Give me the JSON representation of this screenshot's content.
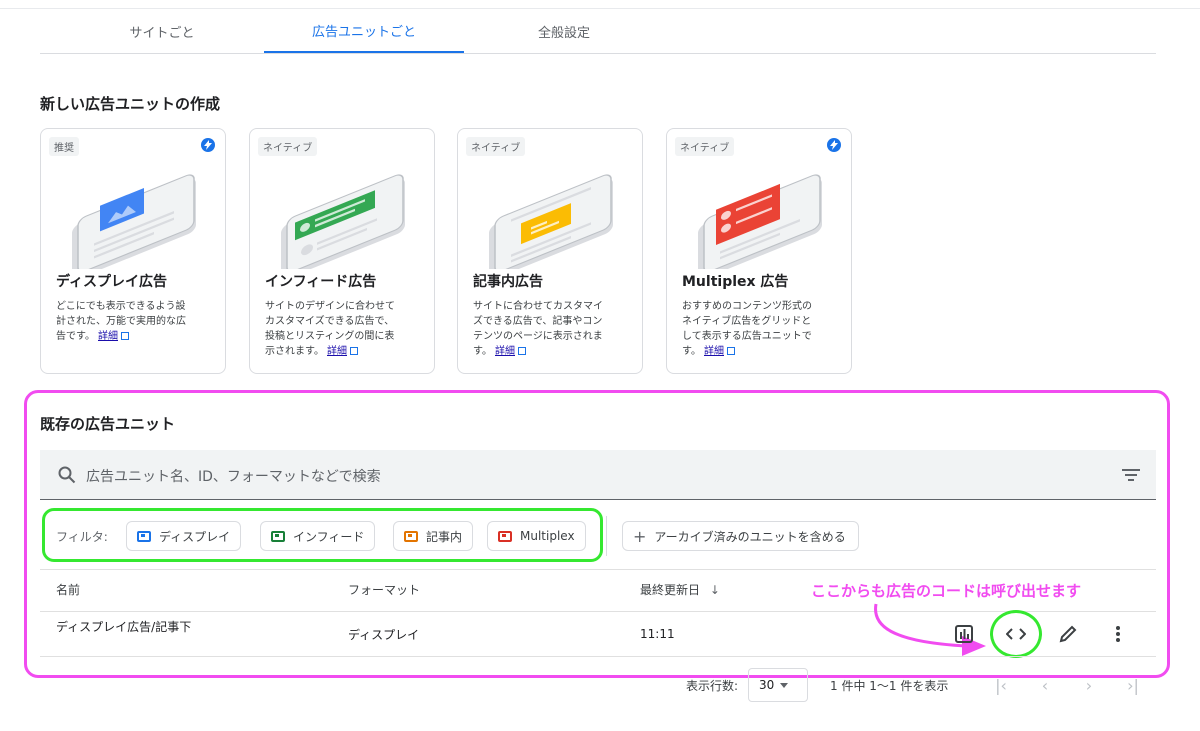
{
  "tabs": [
    {
      "label": "サイトごと",
      "active": false
    },
    {
      "label": "広告ユニットごと",
      "active": true
    },
    {
      "label": "全般設定",
      "active": false
    }
  ],
  "create_section": {
    "title": "新しい広告ユニットの作成",
    "cards": [
      {
        "tag": "推奨",
        "bolt": true,
        "accent": "#4285f4",
        "title": "ディスプレイ広告",
        "desc_lines": [
          "どこにでも表示できるよう設",
          "計された、万能で実用的な広",
          "告です。"
        ],
        "more": "詳細"
      },
      {
        "tag": "ネイティブ",
        "bolt": false,
        "accent": "#34a853",
        "title": "インフィード広告",
        "desc_lines": [
          "サイトのデザインに合わせて",
          "カスタマイズできる広告で、",
          "投稿とリスティングの間に表",
          "示されます。"
        ],
        "more": "詳細"
      },
      {
        "tag": "ネイティブ",
        "bolt": false,
        "accent": "#fbbc04",
        "title": "記事内広告",
        "desc_lines": [
          "サイトに合わせてカスタマイ",
          "ズできる広告で、記事やコン",
          "テンツのページに表示されま",
          "す。"
        ],
        "more": "詳細"
      },
      {
        "tag": "ネイティブ",
        "bolt": true,
        "accent": "#ea4335",
        "title": "Multiplex 広告",
        "desc_lines": [
          "おすすめのコンテンツ形式の",
          "ネイティブ広告をグリッドと",
          "して表示する広告ユニットで",
          "す。"
        ],
        "more": "詳細"
      }
    ]
  },
  "existing_section": {
    "title": "既存の広告ユニット",
    "search_placeholder": "広告ユニット名、ID、フォーマットなどで検索",
    "filter_label": "フィルタ:",
    "filters": [
      {
        "label": "ディスプレイ",
        "color": "#1a73e8"
      },
      {
        "label": "インフィード",
        "color": "#188038"
      },
      {
        "label": "記事内",
        "color": "#e37400"
      },
      {
        "label": "Multiplex",
        "color": "#d93025"
      }
    ],
    "archive_label": "アーカイブ済みのユニットを含める",
    "columns": {
      "name": "名前",
      "format": "フォーマット",
      "updated": "最終更新日"
    },
    "rows": [
      {
        "name": "ディスプレイ広告/記事下",
        "format": "ディスプレイ",
        "updated": "11:11"
      }
    ],
    "row_actions": [
      "report-icon",
      "code-icon",
      "edit-icon",
      "more-vert-icon"
    ]
  },
  "annotation": "ここからも広告のコードは呼び出せます",
  "pagination": {
    "rows_label": "表示行数:",
    "rows_value": "30",
    "range": "1 件中 1〜1 件を表示"
  },
  "colors": {
    "accent": "#1a73e8",
    "highlight_magenta": "#f14cf0",
    "highlight_green": "#35e830"
  }
}
